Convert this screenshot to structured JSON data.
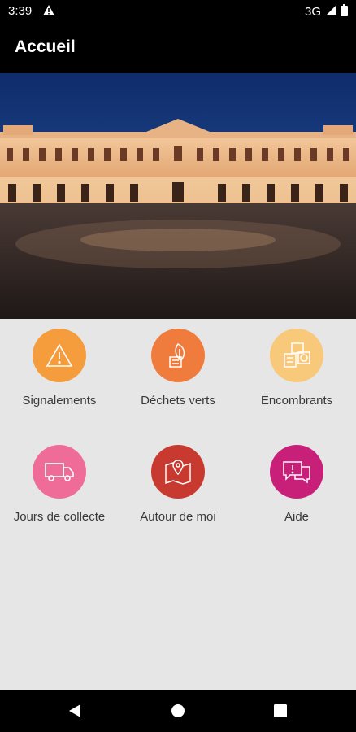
{
  "status_bar": {
    "time": "3:39",
    "network": "3G"
  },
  "app_bar": {
    "title": "Accueil"
  },
  "hero": {
    "icon": "capitole-photo"
  },
  "menu": [
    {
      "label": "Signalements",
      "icon": "warning-icon",
      "color": "#f59d3d"
    },
    {
      "label": "Déchets verts",
      "icon": "green-waste-icon",
      "color": "#ef7c3c"
    },
    {
      "label": "Encombrants",
      "icon": "bulky-items-icon",
      "color": "#f8c97a"
    },
    {
      "label": "Jours de collecte",
      "icon": "truck-icon",
      "color": "#f06c98"
    },
    {
      "label": "Autour de moi",
      "icon": "map-pin-icon",
      "color": "#c8392f"
    },
    {
      "label": "Aide",
      "icon": "chat-help-icon",
      "color": "#c81f79"
    }
  ],
  "colors": {
    "bars": "#000000",
    "background": "#e6e6e6"
  }
}
